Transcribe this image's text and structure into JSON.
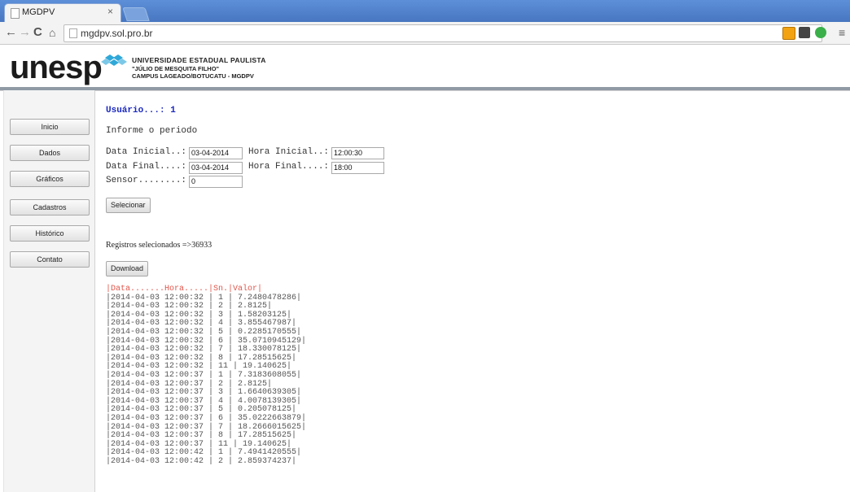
{
  "browser": {
    "tab_title": "MGDPV",
    "tab_close": "×",
    "url": "mgdpv.sol.pro.br",
    "back": "←",
    "forward": "→",
    "reload": "C",
    "home": "⌂",
    "star": "☆",
    "menu": "≡"
  },
  "header": {
    "logo": "unesp",
    "university": "UNIVERSIDADE ESTADUAL PAULISTA",
    "subtitle": "\"JÚLIO DE MESQUITA FILHO\"",
    "campus": "CAMPUS LAGEADO/BOTUCATU - MGDPV"
  },
  "sidebar": {
    "items": [
      {
        "label": "Inicio"
      },
      {
        "label": "Dados"
      },
      {
        "label": "Gráficos"
      },
      {
        "label": "Cadastros"
      },
      {
        "label": "Histórico"
      },
      {
        "label": "Contato"
      }
    ]
  },
  "main": {
    "user_label": "Usuário...: 1",
    "period_label": "Informe o periodo",
    "form": {
      "data_inicial_label": "Data Inicial..:",
      "data_inicial_value": "03-04-2014",
      "hora_inicial_label": "Hora Inicial..:",
      "hora_inicial_value": "12:00:30",
      "data_final_label": "Data Final....:",
      "data_final_value": "03-04-2014",
      "hora_final_label": "Hora Final....:",
      "hora_final_value": "18:00",
      "sensor_label": "Sensor........:",
      "sensor_value": "0"
    },
    "select_button": "Selecionar",
    "registros": "Registros selecionados =>36933",
    "download_button": "Download",
    "results_header": "|Data.......Hora.....|Sn.|Valor|",
    "rows": [
      "|2014-04-03 12:00:32 | 1 | 7.2480478286|",
      "|2014-04-03 12:00:32 | 2 | 2.8125|",
      "|2014-04-03 12:00:32 | 3 | 1.58203125|",
      "|2014-04-03 12:00:32 | 4 | 3.855467987|",
      "|2014-04-03 12:00:32 | 5 | 0.2285170555|",
      "|2014-04-03 12:00:32 | 6 | 35.0710945129|",
      "|2014-04-03 12:00:32 | 7 | 18.330078125|",
      "|2014-04-03 12:00:32 | 8 | 17.28515625|",
      "|2014-04-03 12:00:32 | 11 | 19.140625|",
      "|2014-04-03 12:00:37 | 1 | 7.3183608055|",
      "|2014-04-03 12:00:37 | 2 | 2.8125|",
      "|2014-04-03 12:00:37 | 3 | 1.6640639305|",
      "|2014-04-03 12:00:37 | 4 | 4.0078139305|",
      "|2014-04-03 12:00:37 | 5 | 0.205078125|",
      "|2014-04-03 12:00:37 | 6 | 35.0222663879|",
      "|2014-04-03 12:00:37 | 7 | 18.2666015625|",
      "|2014-04-03 12:00:37 | 8 | 17.28515625|",
      "|2014-04-03 12:00:37 | 11 | 19.140625|",
      "|2014-04-03 12:00:42 | 1 | 7.4941420555|",
      "|2014-04-03 12:00:42 | 2 | 2.859374237|"
    ]
  },
  "colors": {
    "tabbar": "#4f80c9",
    "user_text": "#1a28c0",
    "results_header": "#e0554a",
    "header_divider": "#8f9aa5"
  }
}
